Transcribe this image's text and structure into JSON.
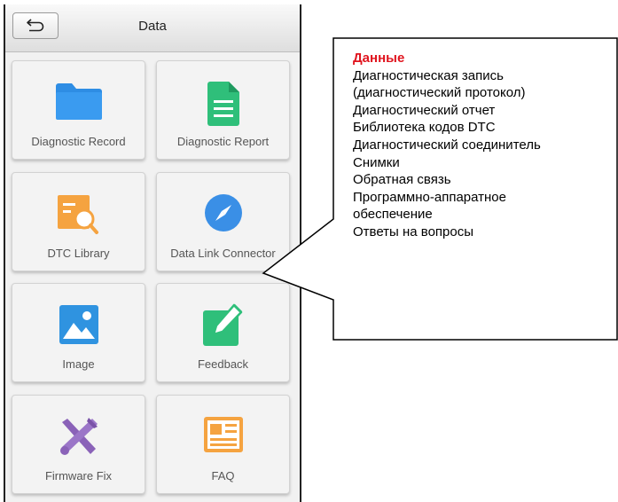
{
  "header": {
    "title": "Data",
    "back_icon": "back-arrow-icon"
  },
  "tiles": [
    {
      "label": "Diagnostic Record",
      "icon": "folder-icon"
    },
    {
      "label": "Diagnostic Report",
      "icon": "document-icon"
    },
    {
      "label": "DTC Library",
      "icon": "dtc-search-icon"
    },
    {
      "label": "Data Link Connector",
      "icon": "compass-icon"
    },
    {
      "label": "Image",
      "icon": "image-icon"
    },
    {
      "label": "Feedback",
      "icon": "edit-icon"
    },
    {
      "label": "Firmware Fix",
      "icon": "tools-icon"
    },
    {
      "label": "FAQ",
      "icon": "faq-icon"
    }
  ],
  "callout": {
    "heading": "Данные",
    "lines": [
      "Диагностическая запись",
      "(диагностический протокол)",
      "Диагностический отчет",
      "Библиотека кодов DTC",
      "Диагностический соединитель",
      "Снимки",
      "Обратная связь",
      "Программно-аппаратное",
      "обеспечение",
      "Ответы на вопросы"
    ]
  },
  "colors": {
    "folder": "#2e8de4",
    "document": "#2fbf7a",
    "dtc": "#f5a340",
    "compass": "#3a8fe6",
    "image": "#2f93e0",
    "feedback": "#2fbf7a",
    "tools": "#8a62b8",
    "faq": "#f5a340",
    "callout_heading": "#e0141e"
  }
}
